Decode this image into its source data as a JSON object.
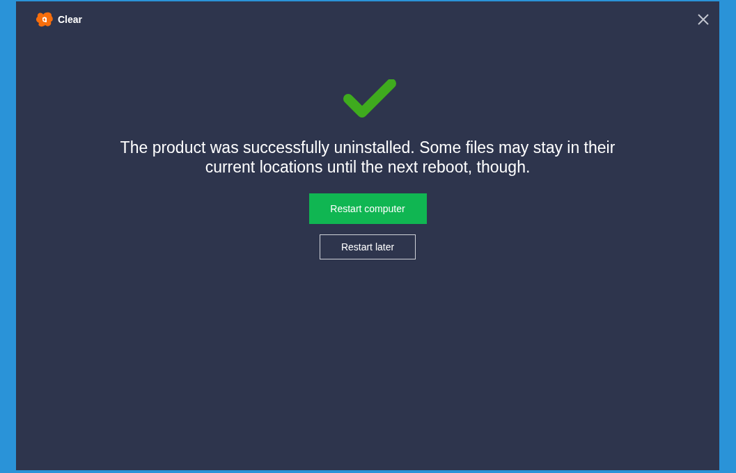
{
  "window": {
    "title": "Clear"
  },
  "message": "The product was successfully uninstalled. Some files may stay in their current locations until the next reboot, though.",
  "buttons": [
    {
      "label": "Restart computer",
      "kind": "primary"
    },
    {
      "label": "Restart later",
      "kind": "secondary"
    }
  ]
}
